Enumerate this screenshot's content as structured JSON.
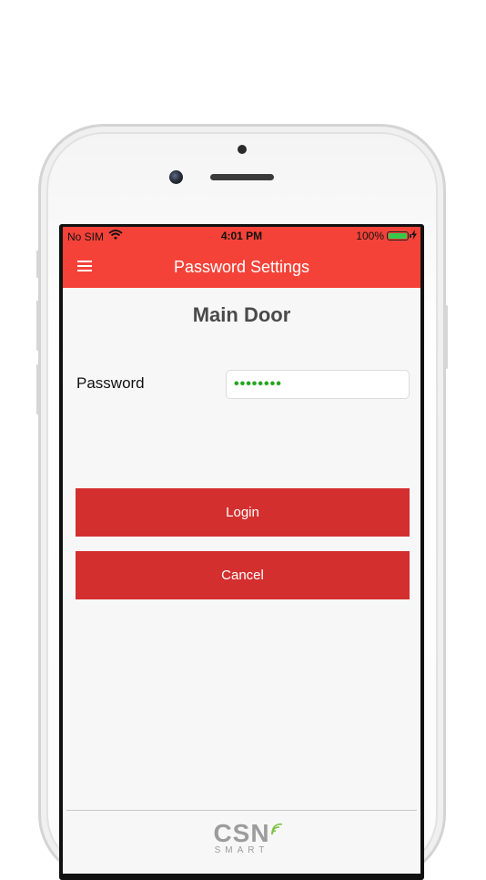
{
  "status_bar": {
    "carrier": "No SIM",
    "time": "4:01 PM",
    "battery": "100%",
    "battery_level": 1.0
  },
  "nav": {
    "title": "Password Settings",
    "menu_icon": "hamburger-menu-icon"
  },
  "door": {
    "title": "Main Door"
  },
  "password": {
    "label": "Password",
    "value": "••••••••"
  },
  "buttons": {
    "login": "Login",
    "cancel": "Cancel"
  },
  "footer": {
    "logo_main": "CSN",
    "logo_sub": "SMART"
  },
  "colors": {
    "accent": "#f54238",
    "button": "#d42f2f",
    "password_dots": "#23a51d",
    "battery": "#35c94a"
  }
}
